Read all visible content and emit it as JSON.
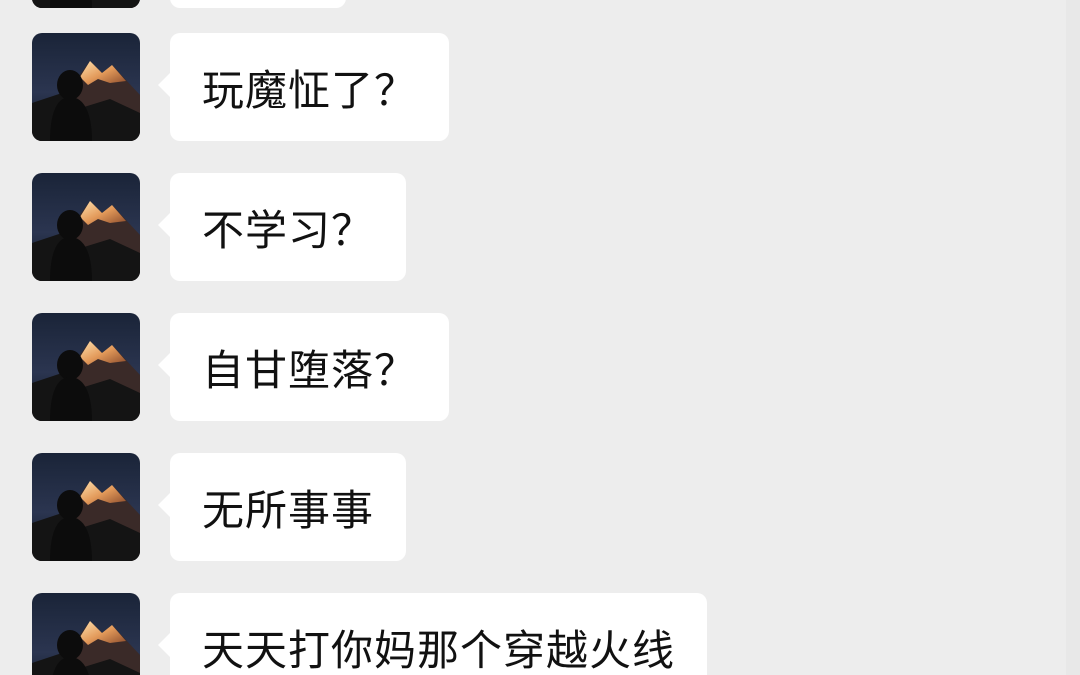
{
  "conversation": {
    "messages": [
      {
        "sender": "other",
        "text": ""
      },
      {
        "sender": "other",
        "text": "玩魔怔了？"
      },
      {
        "sender": "other",
        "text": "不学习？"
      },
      {
        "sender": "other",
        "text": "自甘堕落？"
      },
      {
        "sender": "other",
        "text": "无所事事"
      },
      {
        "sender": "other",
        "text": "天天打你妈那个穿越火线"
      }
    ]
  },
  "colors": {
    "background": "#ededed",
    "bubble": "#ffffff",
    "text": "#111111"
  },
  "icons": {
    "avatar": "avatar-mountain-silhouette"
  }
}
